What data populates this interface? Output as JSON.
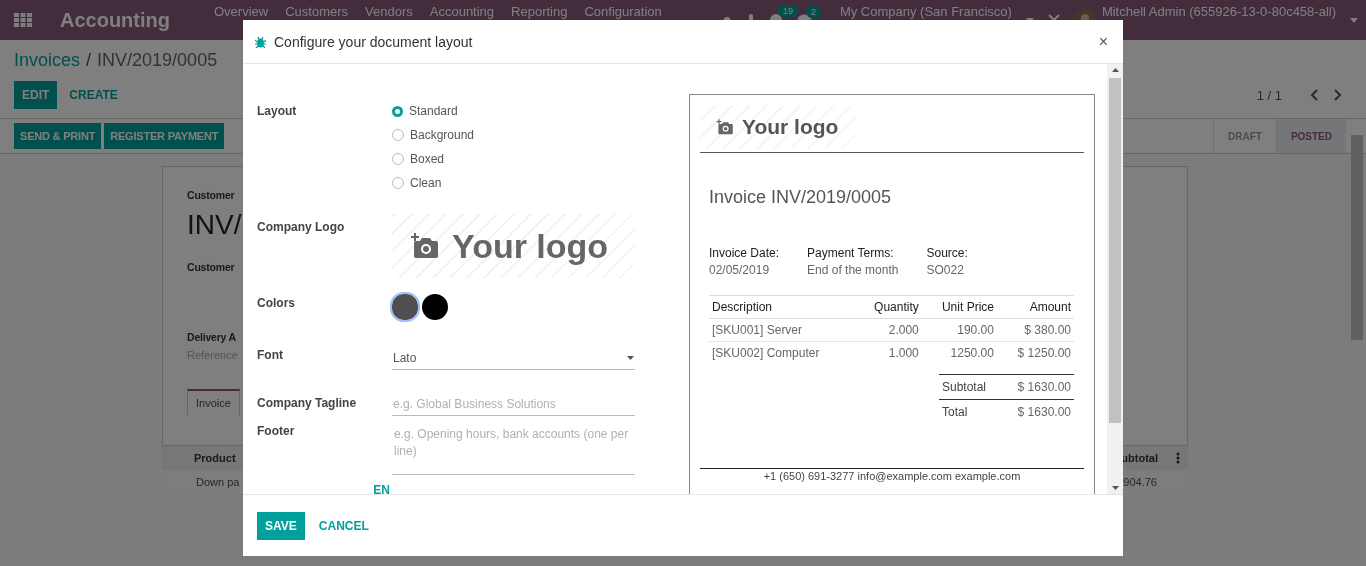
{
  "navbar": {
    "app_title": "Accounting",
    "menu": [
      "Overview",
      "Customers",
      "Vendors",
      "Accounting",
      "Reporting",
      "Configuration"
    ],
    "activity_count": "19",
    "message_count": "2",
    "company": "My Company (San Francisco)",
    "user": "Mitchell Admin (655926-13-0-80c458-all)"
  },
  "breadcrumb": {
    "parent": "Invoices",
    "separator": "/",
    "current": "INV/2019/0005"
  },
  "actions": [
    {
      "label": "EDIT",
      "kind": "primary"
    },
    {
      "label": "CREATE",
      "kind": "link"
    }
  ],
  "pager": "1 / 1",
  "header_buttons": [
    "SEND & PRINT",
    "REGISTER PAYMENT"
  ],
  "statuses": [
    {
      "label": "DRAFT",
      "selected": false
    },
    {
      "label": "POSTED",
      "selected": true
    }
  ],
  "sheet": {
    "type_label": "Customer",
    "number": "INV/",
    "customer_label": "Customer",
    "delivery_label": "Delivery A",
    "reference_label": "Reference",
    "tab": "Invoice",
    "columns": {
      "first": "Product",
      "last": "ubtotal"
    },
    "row": {
      "first": "Down pa",
      "last": "904.76"
    }
  },
  "dialog": {
    "title": "Configure your document layout",
    "close": "×",
    "form": {
      "layout_label": "Layout",
      "layouts": [
        {
          "label": "Standard",
          "selected": true
        },
        {
          "label": "Background",
          "selected": false
        },
        {
          "label": "Boxed",
          "selected": false
        },
        {
          "label": "Clean",
          "selected": false
        }
      ],
      "logo_label": "Company Logo",
      "logo_text": "Your logo",
      "colors_label": "Colors",
      "colors": [
        {
          "color": "#4f4f4f",
          "selected": true
        },
        {
          "color": "#000000",
          "selected": false
        }
      ],
      "font_label": "Font",
      "font": "Lato",
      "tagline_label": "Company Tagline",
      "tagline_placeholder": "e.g. Global Business Solutions",
      "footer_label": "Footer",
      "footer_placeholder": "e.g. Opening hours, bank accounts (one per line)",
      "language": "EN"
    },
    "preview": {
      "logo_text": "Your logo",
      "title": "Invoice INV/2019/0005",
      "info": [
        {
          "label": "Invoice Date:",
          "value": "02/05/2019"
        },
        {
          "label": "Payment Terms:",
          "value": "End of the month"
        },
        {
          "label": "Source:",
          "value": "SO022"
        }
      ],
      "columns": [
        "Description",
        "Quantity",
        "Unit Price",
        "Amount"
      ],
      "rows": [
        [
          "[SKU001] Server",
          "2.000",
          "190.00",
          "$ 380.00"
        ],
        [
          "[SKU002] Computer",
          "1.000",
          "1250.00",
          "$ 1250.00"
        ]
      ],
      "totals": [
        {
          "label": "Subtotal",
          "value": "$ 1630.00"
        },
        {
          "label": "Total",
          "value": "$ 1630.00"
        }
      ],
      "footer": "+1 (650) 691-3277  info@example.com  example.com"
    },
    "buttons": [
      {
        "label": "SAVE",
        "kind": "primary"
      },
      {
        "label": "CANCEL",
        "kind": "link"
      }
    ]
  }
}
